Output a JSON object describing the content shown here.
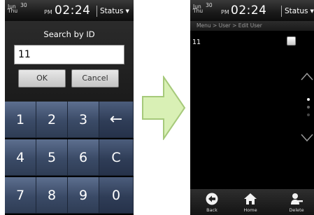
{
  "status_bar": {
    "month": "Jun",
    "date": "30",
    "weekday": "Thu",
    "ampm": "PM",
    "time": "02:24",
    "status_label": "Status"
  },
  "left_screen": {
    "dialog_title": "Search by ID",
    "id_input_value": "11",
    "ok_label": "OK",
    "cancel_label": "Cancel",
    "keys": [
      "1",
      "2",
      "3",
      "←",
      "4",
      "5",
      "6",
      "C",
      "7",
      "8",
      "9",
      "0"
    ]
  },
  "right_screen": {
    "breadcrumb": "Menu > User > Edit User",
    "user_id": "11",
    "nav": {
      "back_label": "Back",
      "home_label": "Home",
      "delete_label": "Delete"
    }
  },
  "colors": {
    "keypad": "#3a4a66",
    "arrow_fill": "#d9f0b5",
    "arrow_stroke": "#a6c97a"
  }
}
